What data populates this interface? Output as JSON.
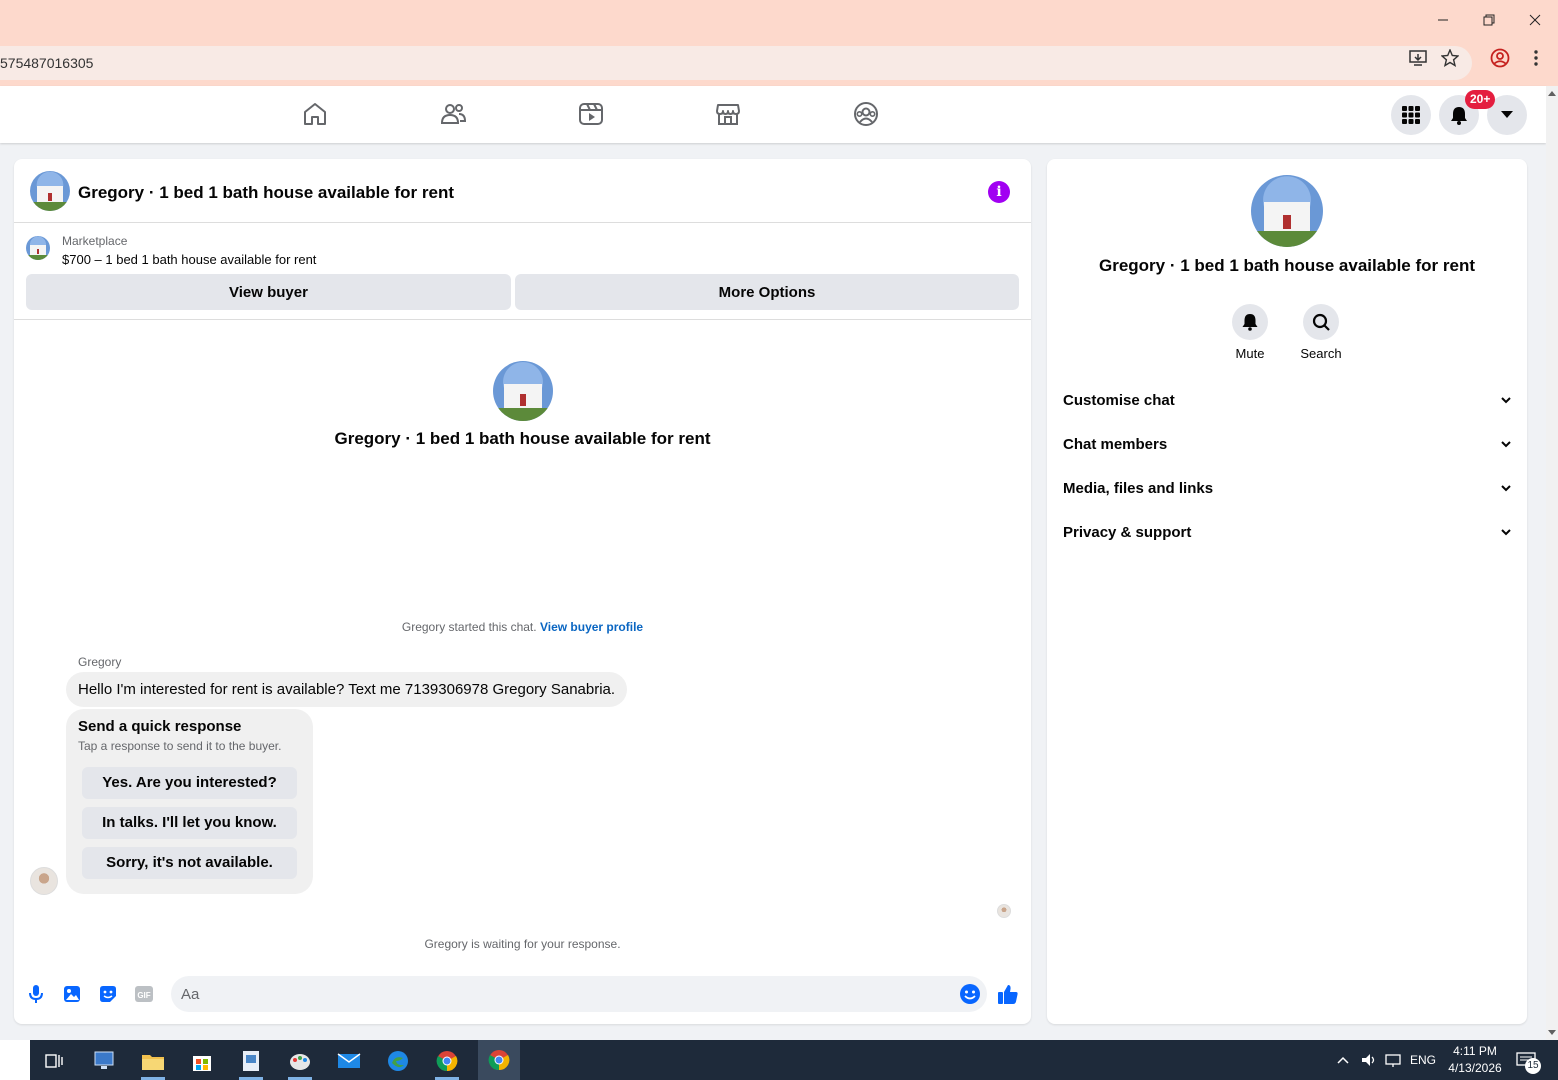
{
  "browser": {
    "url": "575487016305",
    "window_controls": [
      "minimize",
      "restore",
      "close"
    ]
  },
  "nav": {
    "icons": [
      "home-icon",
      "friends-icon",
      "video-icon",
      "marketplace-icon",
      "groups-icon"
    ],
    "notifications_badge": "20+"
  },
  "chat": {
    "title": "Gregory · 1 bed 1 bath house available for rent",
    "marketplace_label": "Marketplace",
    "listing": "$700 – 1 bed 1 bath house available for rent",
    "view_buyer_label": "View buyer",
    "more_options_label": "More Options",
    "center_title": "Gregory · 1 bed 1 bath house available for rent",
    "started_text": "Gregory started this chat.",
    "view_buyer_profile": "View buyer profile",
    "sender": "Gregory",
    "message": "Hello I'm interested for rent is available? Text me 7139306978 Gregory Sanabria.",
    "quick_response": {
      "title": "Send a quick response",
      "subtitle": "Tap a response to send it to the buyer.",
      "options": [
        "Yes. Are you interested?",
        "In talks. I'll let you know.",
        "Sorry, it's not available."
      ]
    },
    "waiting_text": "Gregory is waiting for your response.",
    "composer_placeholder": "Aa"
  },
  "side": {
    "title": "Gregory · 1 bed 1 bath house available for rent",
    "actions": [
      {
        "label": "Mute",
        "icon": "bell-icon"
      },
      {
        "label": "Search",
        "icon": "search-icon"
      }
    ],
    "sections": [
      "Customise chat",
      "Chat members",
      "Media, files and links",
      "Privacy & support"
    ]
  },
  "taskbar": {
    "language": "ENG",
    "time": "4:11 PM",
    "date": "4/13/2026",
    "notification_count": "15"
  },
  "colors": {
    "accent_blue": "#0866ff",
    "info_purple": "#a100f2",
    "badge_red": "#e41e3f",
    "browser_chrome": "#fdd9cc"
  }
}
